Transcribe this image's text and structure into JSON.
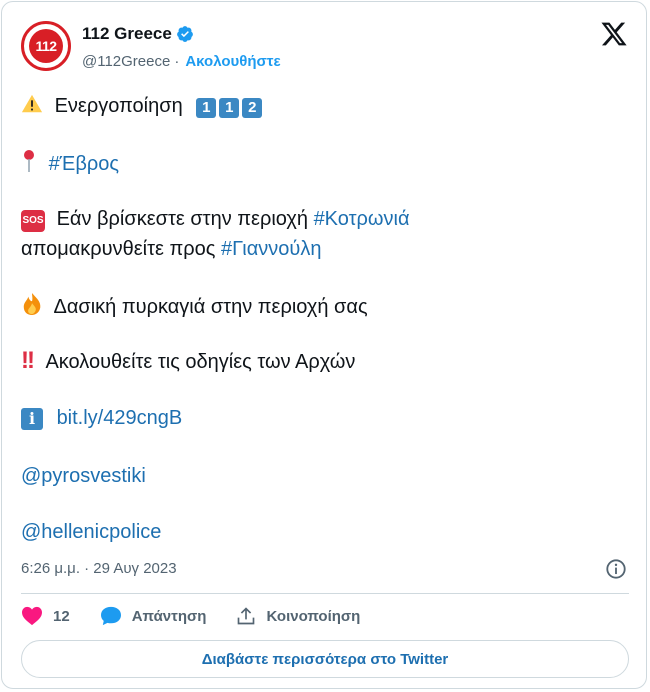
{
  "author": {
    "avatar_text": "112",
    "name": "112 Greece",
    "handle": "@112Greece",
    "separator": "·",
    "follow_label": "Ακολουθήστε"
  },
  "tweet": {
    "line1_text": "Ενεργοποίηση",
    "line1_keys": [
      "1",
      "1",
      "2"
    ],
    "line2_hashtag": "#Έβρος",
    "line3_sos": "SOS",
    "line3_text": "Εάν βρίσκεστε στην περιοχή",
    "line3_hashtag": "#Κοτρωνιά",
    "line4_text": "απομακρυνθείτε προς",
    "line4_hashtag": "#Γιαννούλη",
    "line5_text": "Δασική πυρκαγιά στην περιοχή σας",
    "line6_mark": "!!",
    "line6_text": "Ακολουθείτε τις οδηγίες των Αρχών",
    "line7_info": "i",
    "line7_link": "bit.ly/429cngB",
    "mention1": "@pyrosvestiki",
    "mention2": "@hellenicpolice"
  },
  "meta": {
    "timestamp": "6:26 μ.μ. · 29 Αυγ 2023"
  },
  "actions": {
    "like_count": "12",
    "reply_label": "Απάντηση",
    "share_label": "Κοινοποίηση"
  },
  "footer": {
    "read_more_label": "Διαβάστε περισσότερα στο Twitter"
  },
  "colors": {
    "link": "#1d6fb0",
    "verified": "#1d9bf0",
    "heart": "#f91880",
    "text": "#0f1419",
    "muted": "#536471"
  }
}
